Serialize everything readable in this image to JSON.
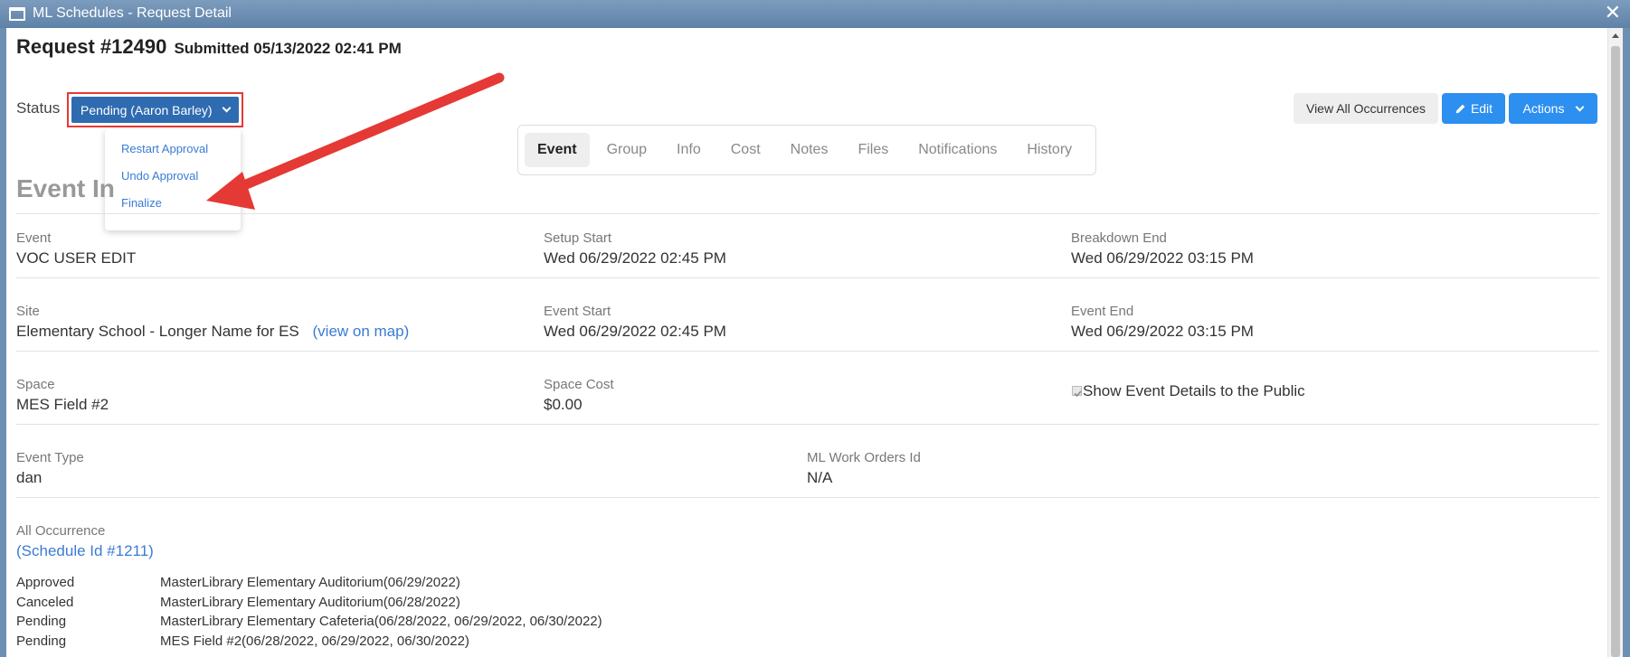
{
  "window": {
    "title": "ML Schedules - Request Detail"
  },
  "header": {
    "request": "Request #12490",
    "submitted": "Submitted 05/13/2022 02:41 PM"
  },
  "status": {
    "label": "Status",
    "value": "Pending (Aaron Barley)",
    "menu": [
      "Restart Approval",
      "Undo Approval",
      "Finalize"
    ]
  },
  "tabs": [
    "Event",
    "Group",
    "Info",
    "Cost",
    "Notes",
    "Files",
    "Notifications",
    "History"
  ],
  "active_tab": "Event",
  "toolbar": {
    "view_all": "View All Occurrences",
    "edit": "Edit",
    "actions": "Actions"
  },
  "section_title": "Event In",
  "fields": {
    "event": {
      "label": "Event",
      "value": "VOC USER EDIT"
    },
    "setup_start": {
      "label": "Setup Start",
      "value": "Wed 06/29/2022 02:45 PM"
    },
    "breakdown_end": {
      "label": "Breakdown End",
      "value": "Wed 06/29/2022 03:15 PM"
    },
    "site": {
      "label": "Site",
      "value": "Elementary School - Longer Name for ES",
      "link": "(view on map)"
    },
    "event_start": {
      "label": "Event Start",
      "value": "Wed 06/29/2022 02:45 PM"
    },
    "event_end": {
      "label": "Event End",
      "value": "Wed 06/29/2022 03:15 PM"
    },
    "space": {
      "label": "Space",
      "value": "MES Field #2"
    },
    "space_cost": {
      "label": "Space Cost",
      "value": "$0.00"
    },
    "show_public": {
      "label": "Show Event Details to the Public",
      "checked": true
    },
    "event_type": {
      "label": "Event Type",
      "value": "dan"
    },
    "work_orders": {
      "label": "ML Work Orders Id",
      "value": "N/A"
    },
    "all_occurrence": {
      "label": "All Occurrence",
      "link": "(Schedule Id #1211)"
    }
  },
  "occurrences": [
    {
      "status": "Approved",
      "detail": "MasterLibrary Elementary Auditorium(06/29/2022)"
    },
    {
      "status": "Canceled",
      "detail": "MasterLibrary Elementary Auditorium(06/28/2022)"
    },
    {
      "status": "Pending",
      "detail": "MasterLibrary Elementary Cafeteria(06/28/2022, 06/29/2022, 06/30/2022)"
    },
    {
      "status": "Pending",
      "detail": "MES Field #2(06/28/2022, 06/29/2022, 06/30/2022)"
    }
  ],
  "colors": {
    "accent": "#2d8ff0",
    "status_btn": "#2f6bb0",
    "annotation": "#e53935",
    "link": "#3a7bd5"
  }
}
